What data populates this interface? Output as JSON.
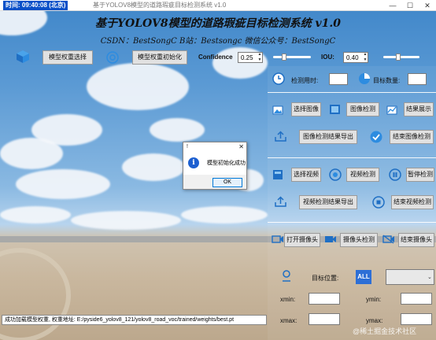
{
  "titlebar": {
    "clock": "时间: 09:40:08 (北京)",
    "window_title": "基于YOLOV8模型的道路瑕疵目标检测系统 v1.0",
    "min": "—",
    "max": "☐",
    "close": "✕"
  },
  "header": {
    "title": "基于YOLOV8模型的道路瑕疵目标检测系统 v1.0",
    "subtitle": "CSDN：BestSongC   B站：Bestsongc   微信公众号：BestSongC"
  },
  "controls": {
    "select_weight": "模型权重选择",
    "init_weight": "模型权重初始化",
    "confidence_label": "Confidence",
    "confidence_value": "0.25",
    "confidence_level": 0.25,
    "iou_label": "IOU:",
    "iou_value": "0.40",
    "iou_level": 0.4
  },
  "panel": {
    "detect_time_label": "检测用时:",
    "detect_time_value": "",
    "target_count_label": "目标数量:",
    "target_count_value": "",
    "select_image": "选择图像",
    "image_detect": "图像检测",
    "show_result": "结果展示",
    "export_image_result": "图像检测结果导出",
    "end_image_detect": "结束图像检测",
    "select_video": "选择视频",
    "video_detect": "视频检测",
    "pause_detect": "暂停检测",
    "export_video_result": "视频检测结果导出",
    "end_video_detect": "结束视频检测",
    "open_camera": "打开摄像头",
    "camera_detect": "摄像头检测",
    "end_camera": "结束摄像头",
    "target_pos_label": "目标位置:",
    "all_badge": "ALL",
    "target_select": "",
    "xmin_label": "xmin:",
    "ymin_label": "ymin:",
    "xmax_label": "xmax:",
    "ymax_label": "ymax:"
  },
  "dialog": {
    "title": "!",
    "message": "模型初始化成功",
    "ok": "OK"
  },
  "status": {
    "text": "成功加载模型权重, 权重地址: E:/pyside6_yolov8_121/yolov8_road_voc/trained/weights/best.pt"
  },
  "watermark": "@稀土掘金技术社区",
  "colors": {
    "accent": "#1c5fd0",
    "icon_blue": "#2d8ce0"
  }
}
